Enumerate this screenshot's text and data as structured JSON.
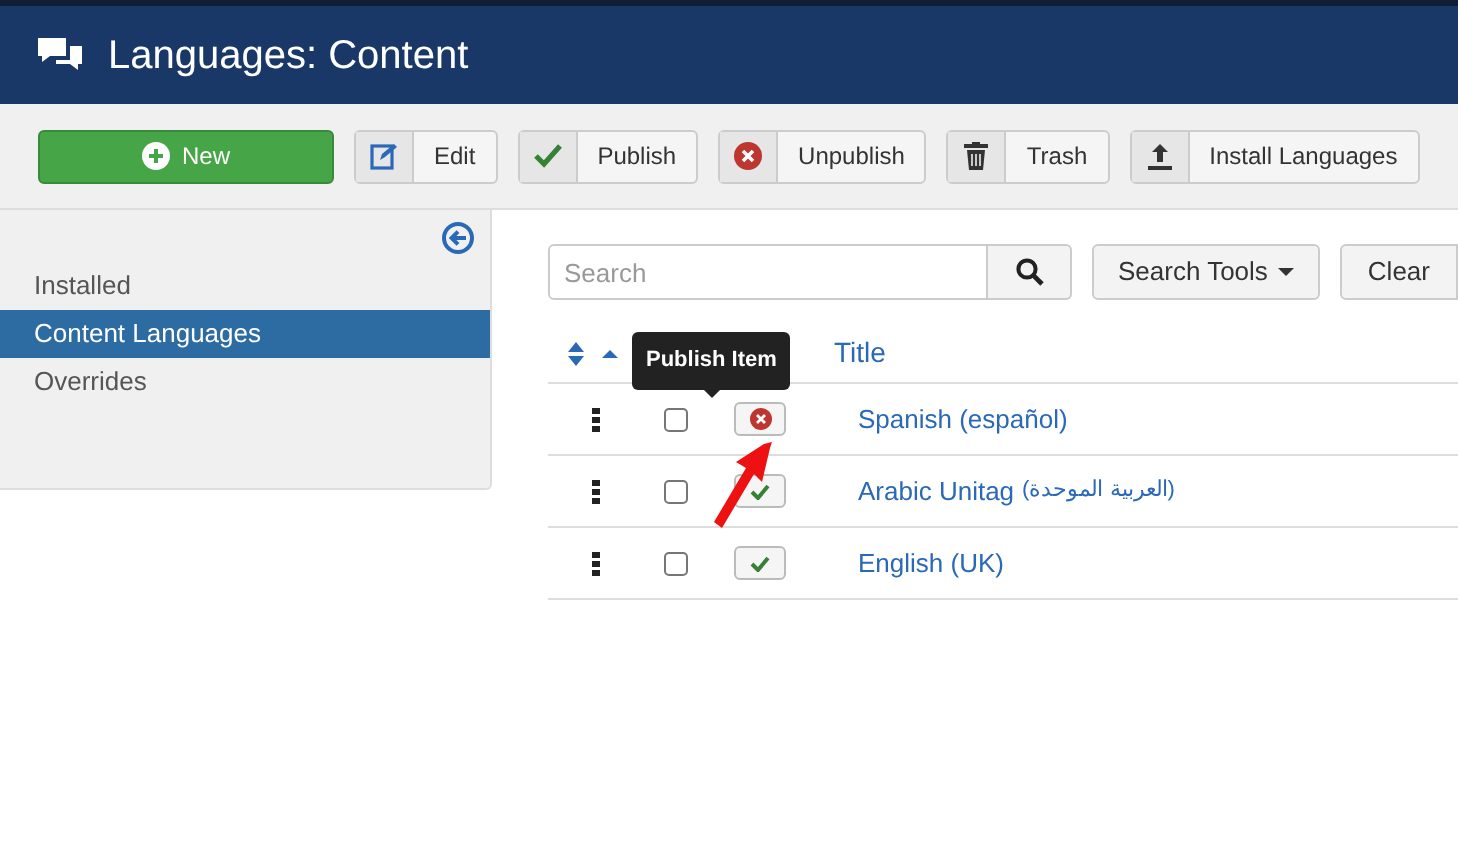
{
  "header": {
    "title": "Languages: Content"
  },
  "toolbar": [
    {
      "kind": "new",
      "label": "New"
    },
    {
      "kind": "edit",
      "label": "Edit"
    },
    {
      "kind": "publish",
      "label": "Publish"
    },
    {
      "kind": "unpublish",
      "label": "Unpublish"
    },
    {
      "kind": "trash",
      "label": "Trash"
    },
    {
      "kind": "install",
      "label": "Install Languages"
    }
  ],
  "sidebar": {
    "items": [
      {
        "label": "Installed",
        "selected": false
      },
      {
        "label": "Content Languages",
        "selected": true
      },
      {
        "label": "Overrides",
        "selected": false
      }
    ]
  },
  "search": {
    "placeholder": "Search",
    "tools_label": "Search Tools",
    "clear_label": "Clear"
  },
  "table": {
    "columns": {
      "title": "Title"
    },
    "rows": [
      {
        "title": "Spanish (español)",
        "published": false,
        "checked": false
      },
      {
        "title": "Arabic Unitag",
        "title_native": "(العربية الموحدة)",
        "published": true,
        "checked": false
      },
      {
        "title": "English (UK)",
        "published": true,
        "checked": false
      }
    ]
  },
  "tooltip": {
    "text": "Publish Item"
  }
}
